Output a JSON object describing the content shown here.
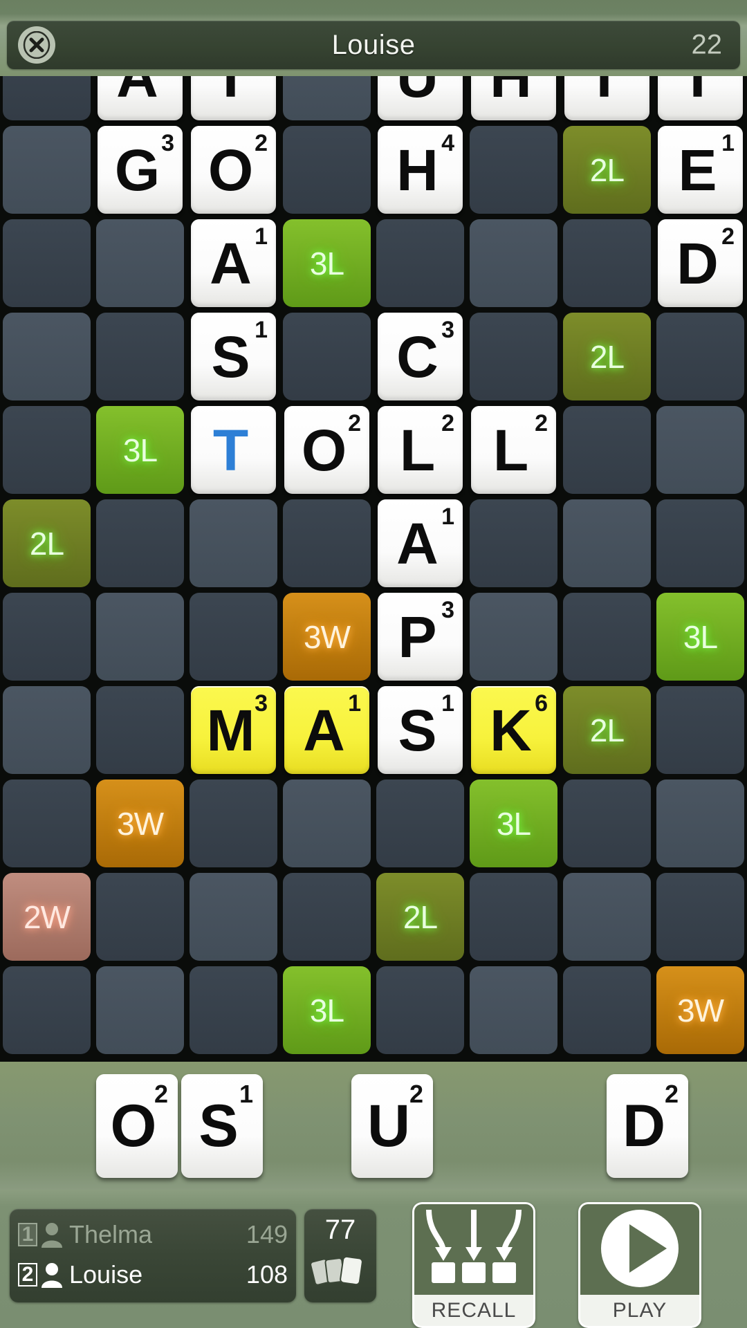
{
  "topbar": {
    "close_icon": "close-circle-icon",
    "title": "Louise",
    "score": "22"
  },
  "board": {
    "rows": 11,
    "cols": 8,
    "cells": [
      [
        {
          "t": "plain"
        },
        {
          "t": "tile",
          "l": "A",
          "v": ""
        },
        {
          "t": "tile",
          "l": "T",
          "v": ""
        },
        {
          "t": "plain"
        },
        {
          "t": "tile",
          "l": "U",
          "v": ""
        },
        {
          "t": "tile",
          "l": "H",
          "v": ""
        },
        {
          "t": "tile",
          "l": "T",
          "v": ""
        },
        {
          "t": "tile",
          "l": "T",
          "v": ""
        }
      ],
      [
        {
          "t": "plain"
        },
        {
          "t": "tile",
          "l": "G",
          "v": "3"
        },
        {
          "t": "tile",
          "l": "O",
          "v": "2"
        },
        {
          "t": "plain"
        },
        {
          "t": "tile",
          "l": "H",
          "v": "4"
        },
        {
          "t": "plain"
        },
        {
          "t": "bonus",
          "b": "2L"
        },
        {
          "t": "tile",
          "l": "E",
          "v": "1"
        }
      ],
      [
        {
          "t": "plain"
        },
        {
          "t": "plain"
        },
        {
          "t": "tile",
          "l": "A",
          "v": "1"
        },
        {
          "t": "bonus",
          "b": "3L"
        },
        {
          "t": "plain"
        },
        {
          "t": "plain"
        },
        {
          "t": "plain"
        },
        {
          "t": "tile",
          "l": "D",
          "v": "2"
        }
      ],
      [
        {
          "t": "plain"
        },
        {
          "t": "plain"
        },
        {
          "t": "tile",
          "l": "S",
          "v": "1"
        },
        {
          "t": "plain"
        },
        {
          "t": "tile",
          "l": "C",
          "v": "3"
        },
        {
          "t": "plain"
        },
        {
          "t": "bonus",
          "b": "2L"
        },
        {
          "t": "plain"
        }
      ],
      [
        {
          "t": "plain"
        },
        {
          "t": "bonus",
          "b": "3L"
        },
        {
          "t": "tile",
          "l": "T",
          "v": "",
          "new": true
        },
        {
          "t": "tile",
          "l": "O",
          "v": "2"
        },
        {
          "t": "tile",
          "l": "L",
          "v": "2"
        },
        {
          "t": "tile",
          "l": "L",
          "v": "2"
        },
        {
          "t": "plain"
        },
        {
          "t": "plain"
        }
      ],
      [
        {
          "t": "bonus",
          "b": "2L"
        },
        {
          "t": "plain"
        },
        {
          "t": "plain"
        },
        {
          "t": "plain"
        },
        {
          "t": "tile",
          "l": "A",
          "v": "1"
        },
        {
          "t": "plain"
        },
        {
          "t": "plain"
        },
        {
          "t": "plain"
        }
      ],
      [
        {
          "t": "plain"
        },
        {
          "t": "plain"
        },
        {
          "t": "plain"
        },
        {
          "t": "bonus",
          "b": "3W"
        },
        {
          "t": "tile",
          "l": "P",
          "v": "3"
        },
        {
          "t": "plain"
        },
        {
          "t": "plain"
        },
        {
          "t": "bonus",
          "b": "3L"
        }
      ],
      [
        {
          "t": "plain"
        },
        {
          "t": "plain"
        },
        {
          "t": "tile",
          "l": "M",
          "v": "3",
          "pend": true
        },
        {
          "t": "tile",
          "l": "A",
          "v": "1",
          "pend": true
        },
        {
          "t": "tile",
          "l": "S",
          "v": "1"
        },
        {
          "t": "tile",
          "l": "K",
          "v": "6",
          "pend": true
        },
        {
          "t": "bonus",
          "b": "2L"
        },
        {
          "t": "plain"
        }
      ],
      [
        {
          "t": "plain"
        },
        {
          "t": "bonus",
          "b": "3W"
        },
        {
          "t": "plain"
        },
        {
          "t": "plain"
        },
        {
          "t": "plain"
        },
        {
          "t": "bonus",
          "b": "3L"
        },
        {
          "t": "plain"
        },
        {
          "t": "plain"
        }
      ],
      [
        {
          "t": "bonus",
          "b": "2W"
        },
        {
          "t": "plain"
        },
        {
          "t": "plain"
        },
        {
          "t": "plain"
        },
        {
          "t": "bonus",
          "b": "2L"
        },
        {
          "t": "plain"
        },
        {
          "t": "plain"
        },
        {
          "t": "plain"
        }
      ],
      [
        {
          "t": "plain"
        },
        {
          "t": "plain"
        },
        {
          "t": "plain"
        },
        {
          "t": "bonus",
          "b": "3L"
        },
        {
          "t": "plain"
        },
        {
          "t": "plain"
        },
        {
          "t": "plain"
        },
        {
          "t": "bonus",
          "b": "3W"
        }
      ]
    ]
  },
  "rack": {
    "slots": [
      {
        "slot": 0,
        "letter": "O",
        "value": "2"
      },
      {
        "slot": 1,
        "letter": "S",
        "value": "1"
      },
      {
        "slot": 2,
        "letter": "",
        "value": ""
      },
      {
        "slot": 3,
        "letter": "U",
        "value": "2"
      },
      {
        "slot": 4,
        "letter": "",
        "value": ""
      },
      {
        "slot": 5,
        "letter": "",
        "value": ""
      },
      {
        "slot": 6,
        "letter": "D",
        "value": "2"
      }
    ]
  },
  "bottom": {
    "players": [
      {
        "rank": "1",
        "name": "Thelma",
        "score": "149",
        "active": false
      },
      {
        "rank": "2",
        "name": "Louise",
        "score": "108",
        "active": true
      }
    ],
    "bag": {
      "count": "77",
      "icon": "tile-bag-icon"
    },
    "recall": {
      "label": "RECALL",
      "icon": "recall-arrows-icon"
    },
    "play": {
      "label": "PLAY",
      "icon": "play-circle-icon"
    }
  },
  "colors": {
    "app_green": "#7d9173",
    "bonus_2l": "#6d7c24",
    "bonus_3l": "#73ae22",
    "bonus_2w": "#ab7568",
    "bonus_3w": "#c07e10",
    "pending_tile": "#f7f23c",
    "new_letter": "#2d7fd6"
  }
}
